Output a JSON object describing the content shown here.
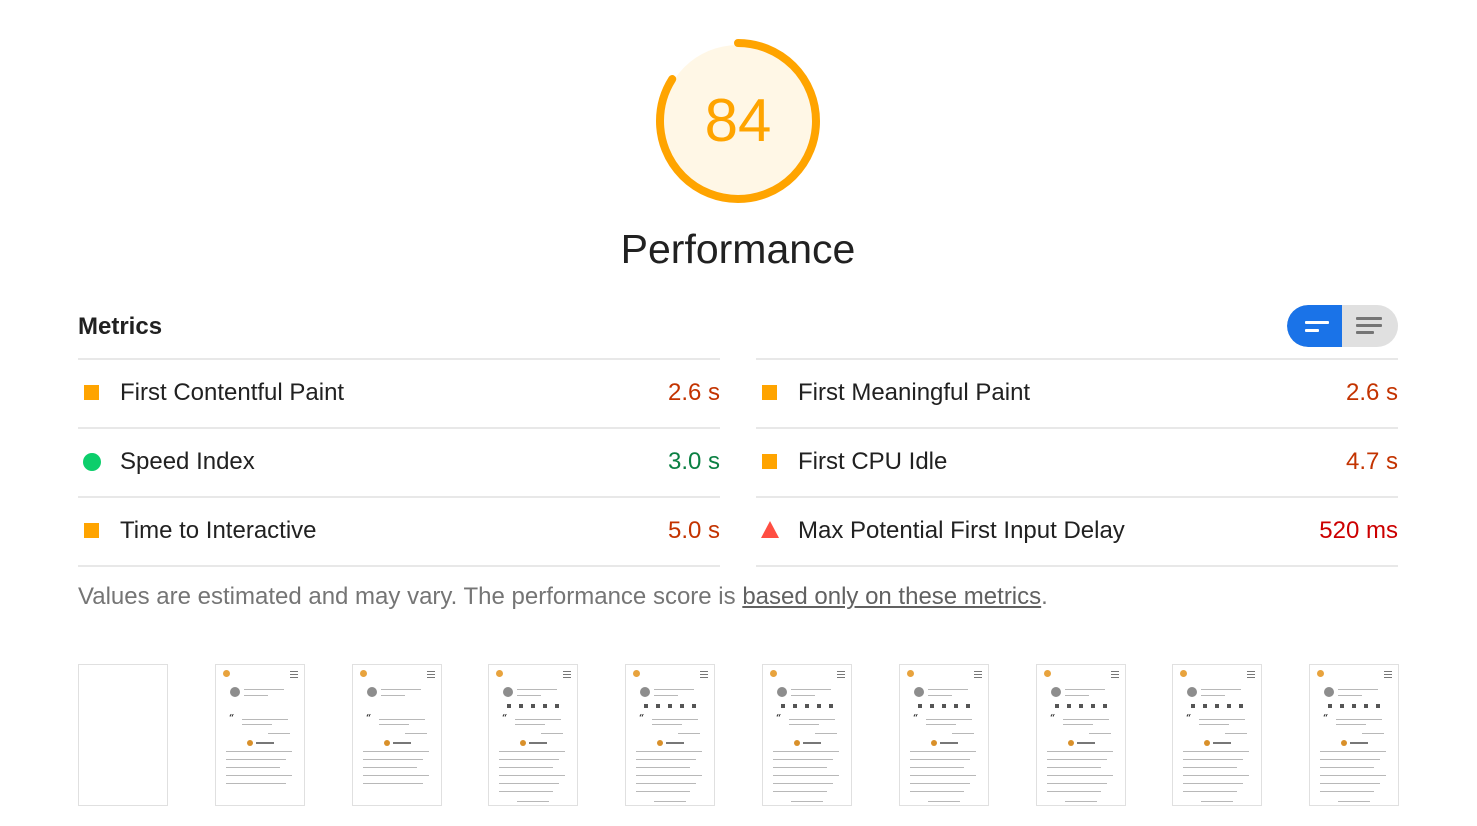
{
  "gauge": {
    "score": "84",
    "title": "Performance",
    "score_fraction": 0.84,
    "color": "#ffa400",
    "fill": "#fff7e6"
  },
  "metrics": {
    "heading": "Metrics",
    "left": [
      {
        "label": "First Contentful Paint",
        "value": "2.6 s",
        "rating": "average",
        "indicator": "square"
      },
      {
        "label": "Speed Index",
        "value": "3.0 s",
        "rating": "pass",
        "indicator": "circle"
      },
      {
        "label": "Time to Interactive",
        "value": "5.0 s",
        "rating": "average",
        "indicator": "square"
      }
    ],
    "right": [
      {
        "label": "First Meaningful Paint",
        "value": "2.6 s",
        "rating": "average",
        "indicator": "square"
      },
      {
        "label": "First CPU Idle",
        "value": "4.7 s",
        "rating": "average",
        "indicator": "square"
      },
      {
        "label": "Max Potential First Input Delay",
        "value": "520 ms",
        "rating": "fail",
        "indicator": "triangle"
      }
    ],
    "toggle": {
      "selected": "compact-view",
      "options": [
        "compact-view-icon",
        "expanded-view-icon"
      ]
    }
  },
  "note": {
    "text": "Values are estimated and may vary. The performance score is ",
    "link": "based only on these metrics",
    "suffix": "."
  },
  "colors": {
    "average": "#ffa400",
    "pass": "#0cce6b",
    "fail": "#ff4e42",
    "toggle_active": "#1a73e8"
  },
  "filmstrip": {
    "frames": [
      "blank",
      "loading",
      "loading",
      "loaded",
      "loaded",
      "loaded",
      "loaded",
      "loaded",
      "loaded",
      "loaded"
    ]
  }
}
